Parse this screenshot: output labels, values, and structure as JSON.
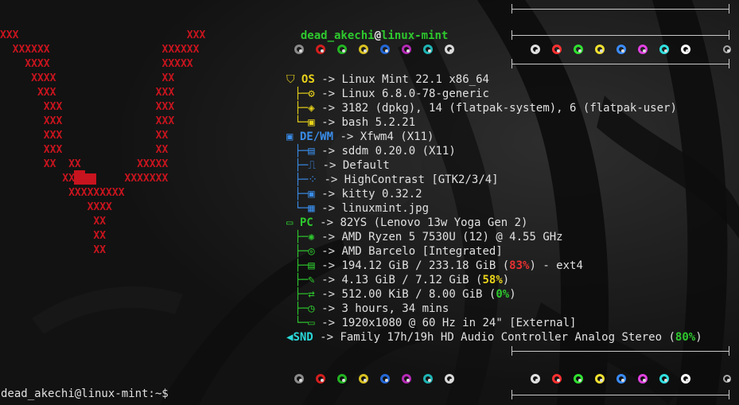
{
  "prompt_user": "dead_akechi",
  "prompt_at": "@",
  "prompt_host": "linux-mint",
  "shell_prompt": "dead_akechi@linux-mint:~$",
  "ascii_art": [
    "XXX                           XXX",
    "  XXXXXX                  XXXXXX",
    "    XXXX                  XXXXX",
    "     XXXX                 XX",
    "      XXX                XXX",
    "       XXX               XXX",
    "       XXX               XXX",
    "       XXX               XX",
    "       XXX               XX",
    "       XX  XX         XXXXX",
    "          XXXX      XXXXXXX",
    "           XXXXXXXXX",
    "              XXXX",
    "               XX",
    "               XX",
    "               XX"
  ],
  "sections": {
    "os": {
      "label": "OS",
      "rows": [
        {
          "icon": "linux-penguin-icon",
          "value": "Linux Mint 22.1 x86_64",
          "label": "OS"
        },
        {
          "icon": "gear-icon",
          "value": "Linux 6.8.0-78-generic"
        },
        {
          "icon": "package-icon",
          "value": "3182 (dpkg), 14 (flatpak-system), 6 (flatpak-user)"
        },
        {
          "icon": "terminal-icon",
          "value": "bash 5.2.21"
        }
      ]
    },
    "de": {
      "label": "DE/WM",
      "rows": [
        {
          "icon": "window-icon",
          "value": "Xfwm4 (X11)",
          "label": "DE/WM"
        },
        {
          "icon": "monitor-icon",
          "value": "sddm 0.20.0 (X11)"
        },
        {
          "icon": "paint-roller-icon",
          "value": "Default"
        },
        {
          "icon": "grid-icon",
          "value": "HighContrast [GTK2/3/4]"
        },
        {
          "icon": "terminal-window-icon",
          "value": "kitty 0.32.2"
        },
        {
          "icon": "image-icon",
          "value": "linuxmint.jpg"
        }
      ]
    },
    "pc": {
      "label": "PC",
      "rows": [
        {
          "icon": "laptop-icon",
          "value": "82YS (Lenovo 13w Yoga Gen 2)",
          "label": "PC"
        },
        {
          "icon": "cpu-icon",
          "value": "AMD Ryzen 5 7530U (12) @ 4.55 GHz"
        },
        {
          "icon": "gpu-icon",
          "value": "AMD Barcelo [Integrated]"
        },
        {
          "icon": "disk-icon",
          "value_pre": "194.12 GiB / 233.18 GiB (",
          "value_pct": "83%",
          "value_post": ") - ext4",
          "pct_color": "#e83030"
        },
        {
          "icon": "memory-icon",
          "value_pre": "4.13 GiB / 7.12 GiB (",
          "value_pct": "58%",
          "value_post": ")",
          "pct_color": "#e8d21a"
        },
        {
          "icon": "swap-icon",
          "value_pre": "512.00 KiB / 8.00 GiB (",
          "value_pct": "0%",
          "value_post": ")",
          "pct_color": "#2ec82e"
        },
        {
          "icon": "clock-icon",
          "value": "3 hours, 34 mins"
        },
        {
          "icon": "display-icon",
          "value": "1920x1080 @ 60 Hz in 24\" [External]"
        }
      ]
    },
    "snd": {
      "label": "SND",
      "value_pre": "Family 17h/19h HD Audio Controller Analog Stereo (",
      "value_pct": "80%",
      "value_post": ")"
    }
  },
  "arrow": "->",
  "palette_colors": [
    "#8a8a8a",
    "#d41e1e",
    "#22b422",
    "#d8c020",
    "#2468d8",
    "#b42ab4",
    "#1eb4b4",
    "#d8d8d8"
  ],
  "palette_bright": [
    "#e0e0e0",
    "#ff3030",
    "#30e030",
    "#f0e030",
    "#3a8cff",
    "#e040e0",
    "#30e0e0",
    "#ffffff"
  ]
}
